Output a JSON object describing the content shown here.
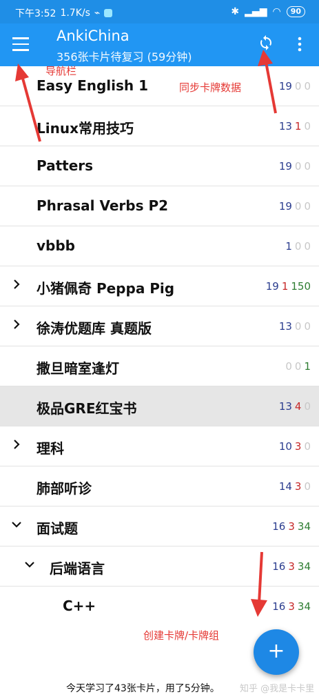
{
  "status_bar": {
    "time": "下午3:52",
    "speed": "1.7K/s",
    "battery": "90"
  },
  "app_bar": {
    "title": "AnkiChina",
    "subtitle": "356张卡片待复习 (59分钟)"
  },
  "decks": [
    {
      "name": "Easy English 1",
      "new": "19",
      "learn": "0",
      "review": "0"
    },
    {
      "name": "Linux常用技巧",
      "new": "13",
      "learn": "1",
      "review": "0"
    },
    {
      "name": "Patters",
      "new": "19",
      "learn": "0",
      "review": "0"
    },
    {
      "name": "Phrasal Verbs P2",
      "new": "19",
      "learn": "0",
      "review": "0"
    },
    {
      "name": "vbbb",
      "new": "1",
      "learn": "0",
      "review": "0"
    },
    {
      "name": "小猪佩奇 Peppa Pig",
      "new": "19",
      "learn": "1",
      "review": "150"
    },
    {
      "name": "徐涛优题库 真题版",
      "new": "13",
      "learn": "0",
      "review": "0"
    },
    {
      "name": "撒旦暗室逢灯",
      "new": "0",
      "learn": "0",
      "review": "1"
    },
    {
      "name": "极品GRE红宝书",
      "new": "13",
      "learn": "4",
      "review": "0"
    },
    {
      "name": "理科",
      "new": "10",
      "learn": "3",
      "review": "0"
    },
    {
      "name": "肺部听诊",
      "new": "14",
      "learn": "3",
      "review": "0"
    },
    {
      "name": "面试题",
      "new": "16",
      "learn": "3",
      "review": "34"
    },
    {
      "name": "后端语言",
      "new": "16",
      "learn": "3",
      "review": "34"
    },
    {
      "name": "C++",
      "new": "16",
      "learn": "3",
      "review": "34"
    }
  ],
  "annotations": {
    "nav": "导航栏",
    "sync": "同步卡牌数据",
    "create": "创建卡牌/卡牌组"
  },
  "footer": {
    "message": "今天学习了43张卡片，用了5分钟。",
    "watermark": "知乎 @我是卡卡里"
  },
  "colors": {
    "primary": "#2196f3",
    "annotation": "#e53935"
  }
}
